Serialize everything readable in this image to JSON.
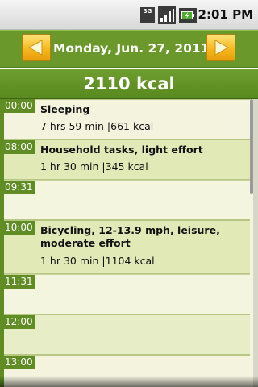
{
  "status_bar": {
    "network": "3G",
    "time": "2:01 PM",
    "icons": [
      "3g-icon",
      "signal-icon",
      "battery-charging-icon"
    ]
  },
  "header": {
    "date": "Monday, Jun. 27, 2011",
    "prev_icon": "arrow-left-icon",
    "next_icon": "arrow-right-icon"
  },
  "total": {
    "label": "2110 kcal"
  },
  "timeline": {
    "times": [
      "00:00",
      "08:00",
      "09:31",
      "10:00",
      "11:31",
      "12:00",
      "13:00"
    ],
    "activities": [
      {
        "name": "Sleeping",
        "duration": "7 hrs 59 min",
        "kcal": "|661 kcal"
      },
      {
        "name": "Household tasks, light effort",
        "duration": "1 hr 30 min",
        "kcal": "|345 kcal"
      },
      {
        "name": "Bicycling, 12-13.9 mph, leisure, moderate effort",
        "duration": "1 hr 30 min",
        "kcal": "|1104 kcal"
      }
    ]
  },
  "colors": {
    "header_green": "#6a982b",
    "time_tag_green": "#5f8d24",
    "nav_button_yellow": "#f7b81e",
    "row_light": "#f3f3de",
    "row_medium": "#e1e9b7"
  }
}
